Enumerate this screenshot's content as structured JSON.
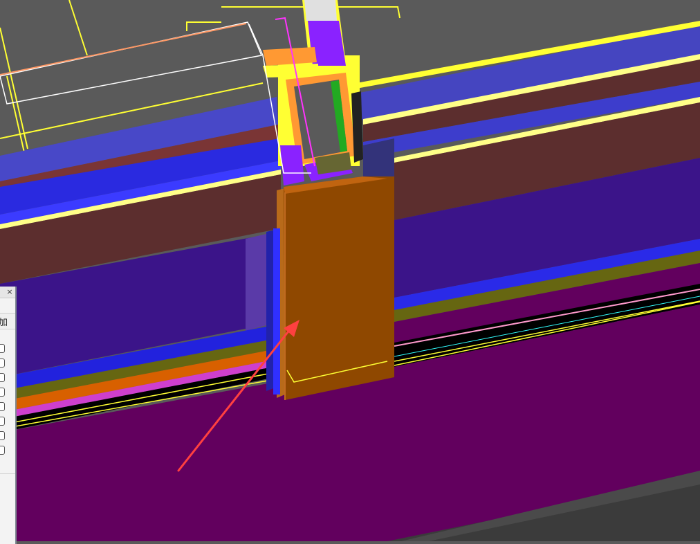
{
  "window": {
    "title": ""
  },
  "viewport": {
    "description_icon": "pointer-arrow-icon",
    "colors": {
      "background": "#5a5a5a",
      "beam_blue": "#2f2fd8",
      "beam_brown": "#5c2e2e",
      "wall_indigo": "#3b1489",
      "floor_purple": "#62005e",
      "column_orange": "#8f4800",
      "edge_yellow": "#ffff55",
      "accent_violet": "#8a22ff",
      "annotation_arrow": "#ff4040"
    }
  },
  "dialog": {
    "close_label": "×",
    "header_label": "加",
    "rows": [
      {
        "checked": false
      },
      {
        "checked": false
      },
      {
        "checked": false
      },
      {
        "checked": false
      },
      {
        "checked": false
      },
      {
        "checked": false
      },
      {
        "checked": false
      },
      {
        "checked": false
      }
    ]
  }
}
